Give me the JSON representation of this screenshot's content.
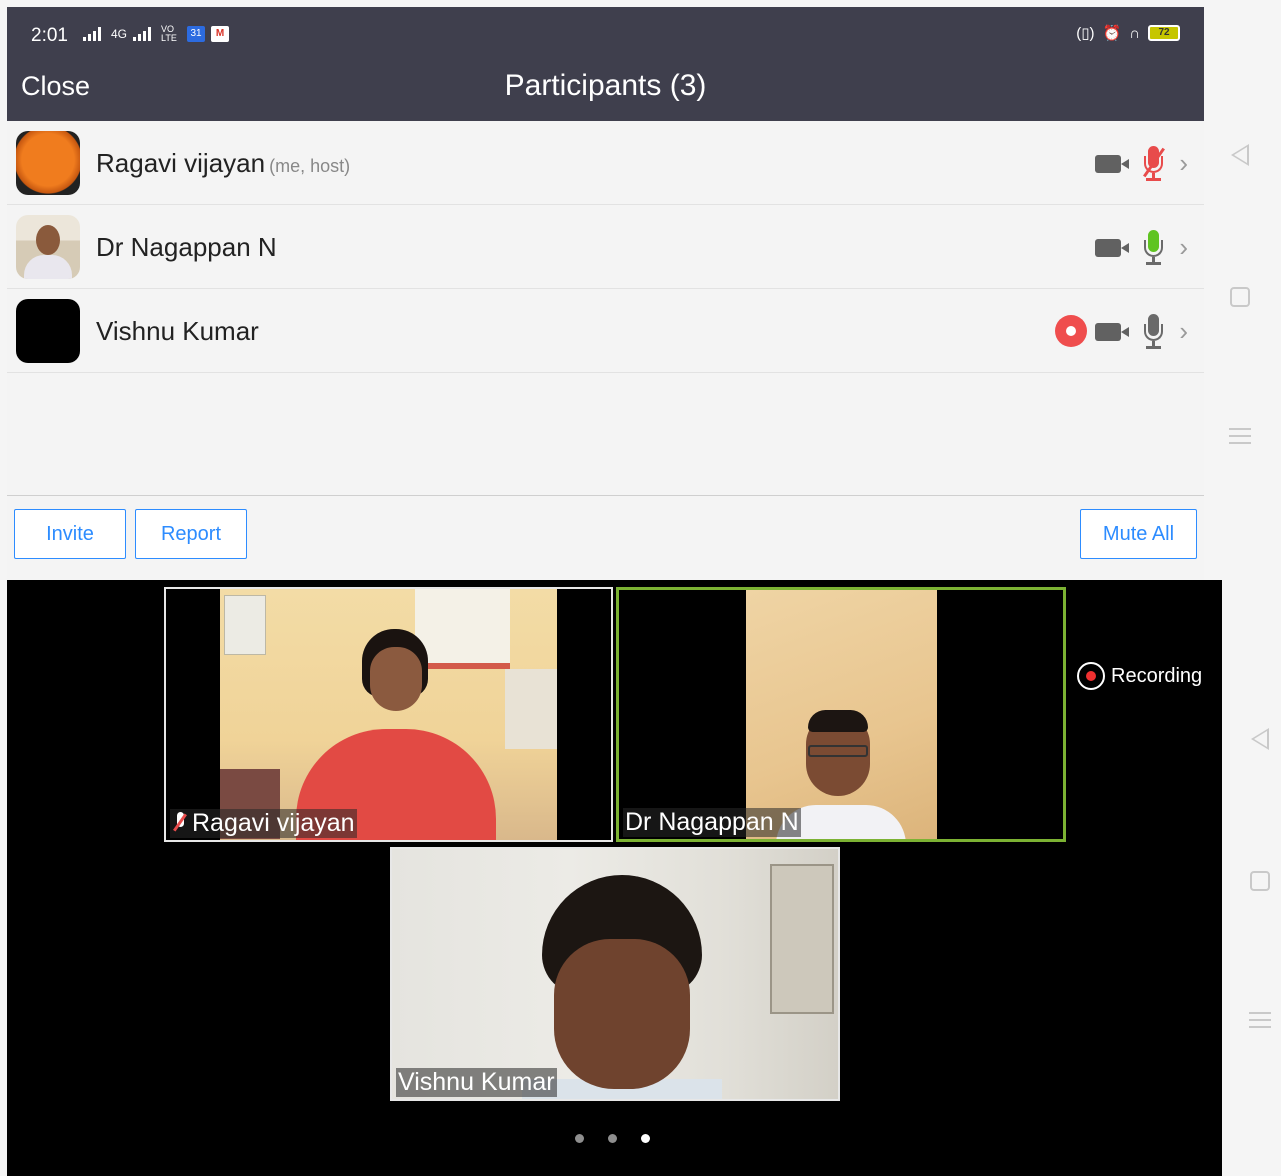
{
  "status_bar": {
    "time": "2:01",
    "network_4g": "4G",
    "volte": "VO LTE",
    "calendar_badge": "31",
    "gmail_badge": "M",
    "battery": "72"
  },
  "header": {
    "close_label": "Close",
    "title": "Participants (3)"
  },
  "participants": [
    {
      "name": "Ragavi vijayan",
      "tag": "(me, host)",
      "mic": "muted",
      "recording": false
    },
    {
      "name": "Dr Nagappan N",
      "tag": "",
      "mic": "active",
      "recording": false
    },
    {
      "name": "Vishnu Kumar",
      "tag": "",
      "mic": "on",
      "recording": true
    }
  ],
  "footer": {
    "invite_label": "Invite",
    "report_label": "Report",
    "mute_all_label": "Mute All"
  },
  "video": {
    "tiles": [
      {
        "name": "Ragavi vijayan",
        "muted": true
      },
      {
        "name": "Dr Nagappan N",
        "active_speaker": true
      },
      {
        "name": "Vishnu Kumar"
      }
    ],
    "recording_label": "Recording",
    "pages": 3,
    "current_page": 3
  },
  "colors": {
    "header_bg": "#3f3f4d",
    "accent_blue": "#2d8cff",
    "active_speaker_border": "#7cb233",
    "recording_red": "#ef4d4d",
    "mic_green": "#5fc421"
  },
  "icons": {
    "camera": "video-camera-icon",
    "mic": "microphone-icon",
    "chevron": "chevron-right-icon",
    "record": "record-icon"
  }
}
